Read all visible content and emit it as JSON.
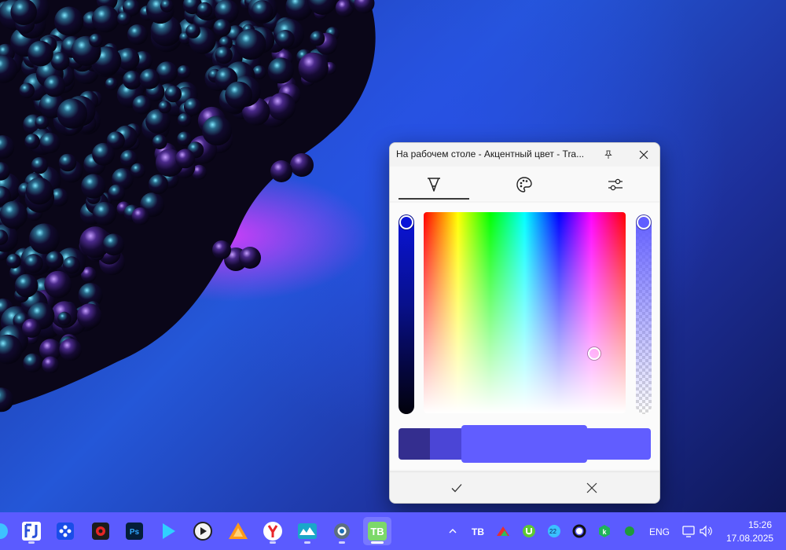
{
  "window": {
    "title": "На рабочем столе - Акцентный цвет - Tra...",
    "tabs": [
      {
        "icon": "eyedropper-icon"
      },
      {
        "icon": "palette-icon"
      },
      {
        "icon": "sliders-icon"
      }
    ],
    "selected_color": "#615dff",
    "swatches": [
      "#342e8f",
      "#4b45d6",
      "#615dff",
      "#615dff"
    ],
    "confirm_icon": "checkmark-icon",
    "cancel_icon": "close-icon"
  },
  "taskbar": {
    "apps": [
      {
        "name": "FJ",
        "icon": "fj-app-icon"
      },
      {
        "name": "puzzle-app",
        "icon": "puzzle-icon"
      },
      {
        "name": "recorder",
        "icon": "record-icon"
      },
      {
        "name": "Ps",
        "icon": "photoshop-icon"
      },
      {
        "name": "player",
        "icon": "play-icon"
      },
      {
        "name": "media-player",
        "icon": "media-play-icon"
      },
      {
        "name": "aimp",
        "icon": "triangle-app-icon"
      },
      {
        "name": "yandex-browser",
        "icon": "yandex-icon"
      },
      {
        "name": "monitor-app",
        "icon": "wave-app-icon"
      },
      {
        "name": "settings-app",
        "icon": "gear-app-icon"
      },
      {
        "name": "TB",
        "icon": "translucenttb-icon"
      }
    ],
    "tray": {
      "badge_number": "22",
      "language": "ENG",
      "time": "15:26",
      "date": "17.08.2025"
    }
  },
  "colors": {
    "taskbar_bg": "#5b5bff",
    "accent": "#615dff"
  }
}
